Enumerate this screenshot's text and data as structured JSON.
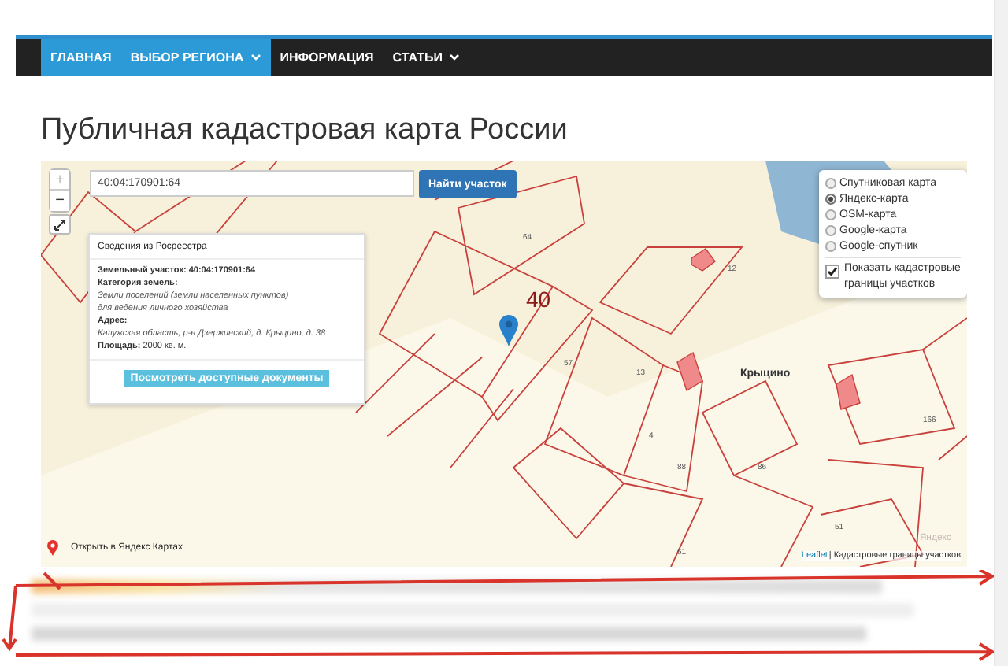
{
  "nav": {
    "items": [
      {
        "label": "ГЛАВНАЯ",
        "selected": true,
        "dropdown": false
      },
      {
        "label": "ВЫБОР РЕГИОНА",
        "selected": true,
        "dropdown": true
      },
      {
        "label": "ИНФОРМАЦИЯ",
        "selected": false,
        "dropdown": false
      },
      {
        "label": "СТАТЬИ",
        "selected": false,
        "dropdown": true
      }
    ]
  },
  "page_title": "Публичная кадастровая карта России",
  "map": {
    "zoom_in": "+",
    "zoom_out": "−",
    "search": {
      "value": "40:04:170901:64"
    },
    "search_button": "Найти участок",
    "popup": {
      "title": "Сведения из Росреестра",
      "lines": [
        {
          "kind": "bold",
          "text": "Земельный участок: 40:04:170901:64"
        },
        {
          "kind": "bold",
          "text": "Категория земель:"
        },
        {
          "kind": "italic",
          "text": "Земли поселений (земли населенных пунктов)"
        },
        {
          "kind": "italic",
          "text": "для ведения личного хозяйства"
        },
        {
          "kind": "bold",
          "text": "Адрес:"
        },
        {
          "kind": "italic",
          "text": "Калужская область, р-н Дзержинский, д. Крыцино, д. 38"
        },
        {
          "kind": "mixed",
          "text": "**Площадь:** 2000 кв. м."
        }
      ],
      "button": "Посмотреть доступные документы"
    },
    "layers": [
      {
        "label": "Спутниковая карта",
        "selected": false
      },
      {
        "label": "Яндекс-карта",
        "selected": true
      },
      {
        "label": "OSM-карта",
        "selected": false
      },
      {
        "label": "Google-карта",
        "selected": false
      },
      {
        "label": "Google-спутник",
        "selected": false
      }
    ],
    "overlay": {
      "label": "Показать кадастровые границы участков",
      "checked": true
    },
    "labels": [
      "40",
      "Крыцино",
      "64",
      "12",
      "57",
      "13",
      "4",
      "88",
      "86",
      "61",
      "51",
      "166"
    ],
    "open_link": "Открыть в Яндекс Картах",
    "yandex_logo": "Яндекс",
    "attribution": {
      "link": "Leaflet",
      "text": "| Кадастровые границы участков"
    }
  }
}
